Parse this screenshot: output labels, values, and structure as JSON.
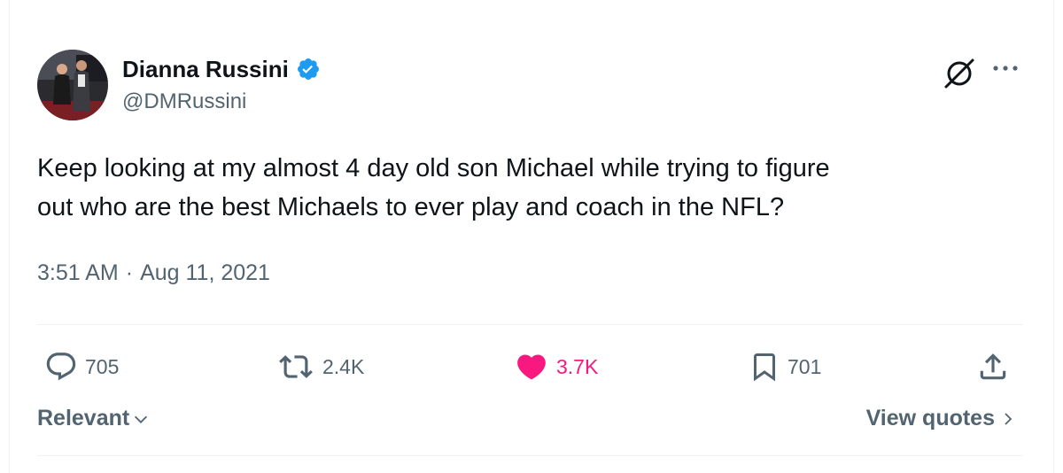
{
  "author": {
    "display_name": "Dianna Russini",
    "handle": "@DMRussini",
    "verified": true
  },
  "tweet": {
    "text_line1": "Keep looking at my almost 4 day old son Michael while trying to figure",
    "text_line2": "out who are the best Michaels to ever play and coach in the NFL?",
    "time": "3:51 AM",
    "separator": "·",
    "date": "Aug 11, 2021"
  },
  "actions": {
    "replies": "705",
    "reposts": "2.4K",
    "likes": "3.7K",
    "bookmarks": "701"
  },
  "footer": {
    "sort_label": "Relevant",
    "view_quotes_label": "View quotes"
  },
  "icons": [
    "grok-icon",
    "more-icon",
    "reply-icon",
    "retweet-icon",
    "heart-icon",
    "bookmark-icon",
    "share-icon",
    "verified-badge-icon"
  ],
  "colors": {
    "like_pink": "#f91880",
    "verified_blue": "#1d9bf0",
    "secondary_text": "#536471",
    "primary_text": "#0f1419"
  }
}
